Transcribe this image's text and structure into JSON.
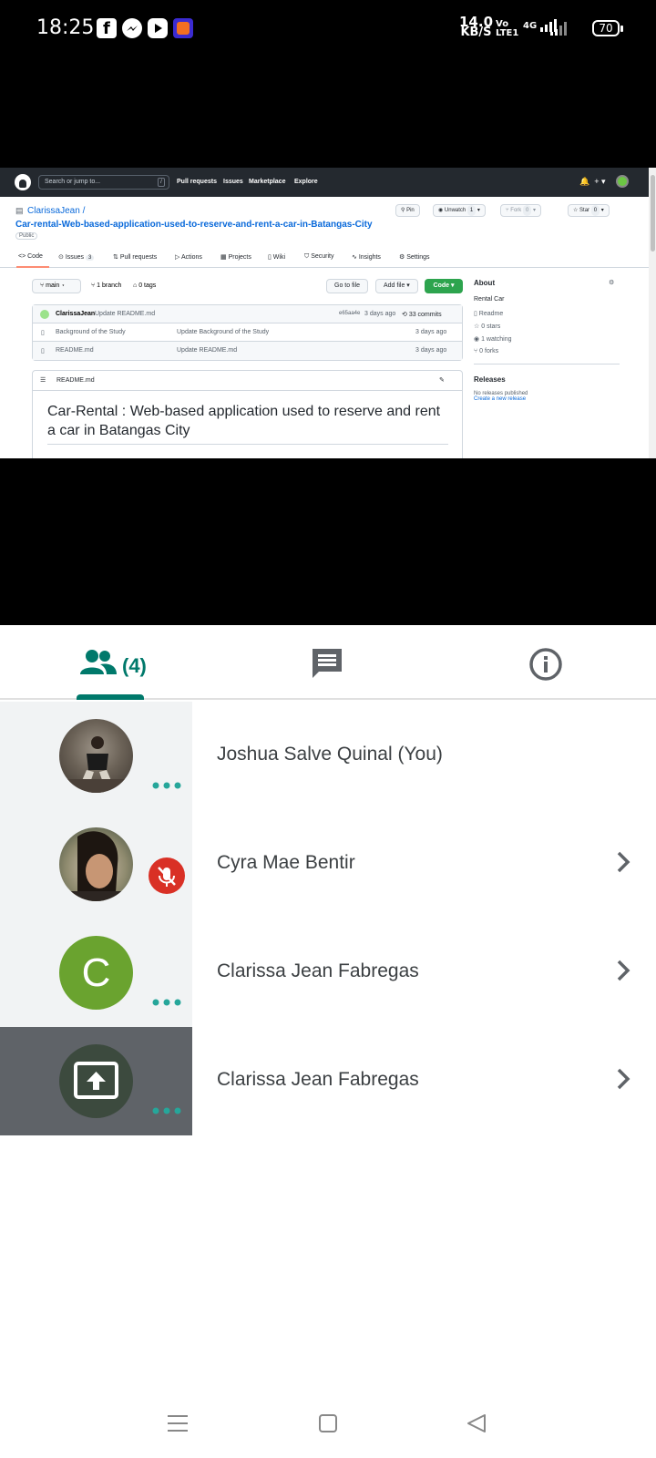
{
  "status_bar": {
    "time": "18:25",
    "app_icons": [
      "facebook-icon",
      "messenger-icon",
      "youtube-icon",
      "lazada-icon"
    ],
    "net_speed_value": "14.0",
    "net_speed_unit": "KB/S",
    "volte_top": "Vo",
    "volte_bottom": "LTE1",
    "network": "4G",
    "battery": "70"
  },
  "shared_screen": {
    "github": {
      "search_placeholder": "Search or jump to...",
      "search_shortcut": "/",
      "nav": [
        "Pull requests",
        "Issues",
        "Marketplace",
        "Explore"
      ],
      "repo_owner": "ClarissaJean /",
      "repo_name": "Car-rental-Web-based-application-used-to-reserve-and-rent-a-car-in-Batangas-City",
      "visibility": "Public",
      "pin": "Pin",
      "unwatch": "Unwatch",
      "unwatch_count": "1",
      "fork": "Fork",
      "fork_count": "0",
      "star": "Star",
      "star_count": "0",
      "tabs": [
        {
          "label": "Code"
        },
        {
          "label": "Issues",
          "count": "3"
        },
        {
          "label": "Pull requests"
        },
        {
          "label": "Actions"
        },
        {
          "label": "Projects"
        },
        {
          "label": "Wiki"
        },
        {
          "label": "Security"
        },
        {
          "label": "Insights"
        },
        {
          "label": "Settings"
        }
      ],
      "branch": "main",
      "branches": "1 branch",
      "tags": "0 tags",
      "go_to_file": "Go to file",
      "add_file": "Add file",
      "code_btn": "Code",
      "commit_author": "ClarissaJean",
      "commit_msg": "Update README.md",
      "commit_hash": "e65aa4e",
      "commit_time": "3 days ago",
      "commits": "33 commits",
      "files": [
        {
          "name": "Background of the Study",
          "message": "Update Background of the Study",
          "time": "3 days ago"
        },
        {
          "name": "README.md",
          "message": "Update README.md",
          "time": "3 days ago"
        }
      ],
      "readme_label": "README.md",
      "readme_title": "Car-Rental : Web-based application used to reserve and rent a car in Batangas City",
      "about": {
        "heading": "About",
        "description": "Rental Car",
        "readme": "Readme",
        "stars": "0 stars",
        "watching": "1 watching",
        "forks": "0 forks",
        "releases_heading": "Releases",
        "no_releases": "No releases published",
        "create_release": "Create a new release"
      }
    }
  },
  "meet": {
    "tabs": {
      "people_count": "(4)"
    },
    "participants": [
      {
        "name": "Joshua Salve Quinal (You)",
        "status": "more-options"
      },
      {
        "name": "Cyra Mae Bentir",
        "status": "muted"
      },
      {
        "name": "Clarissa Jean Fabregas",
        "status": "more-options",
        "initial": "C"
      },
      {
        "name": "Clarissa Jean Fabregas",
        "status": "more-options",
        "presenting": true
      }
    ],
    "colors": {
      "accent": "#00796b",
      "dots": "#26a69a",
      "muted": "#d93025",
      "avatar_c": "#6aa32f",
      "presenting_bg": "#5f6368"
    }
  },
  "nav_bar": [
    "menu-icon",
    "home-icon",
    "back-icon"
  ]
}
